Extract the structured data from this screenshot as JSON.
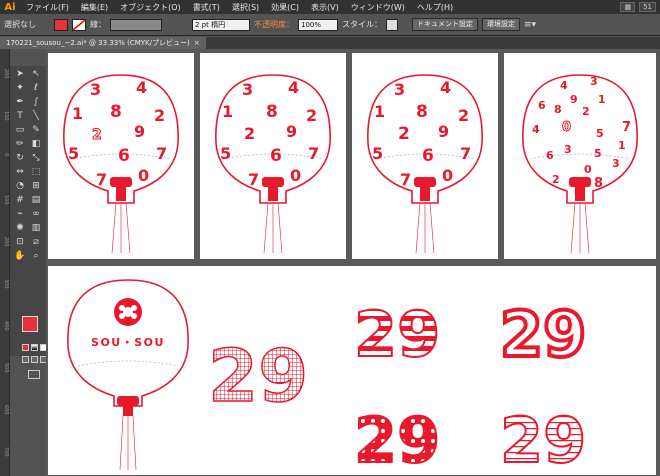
{
  "app": {
    "logo": "Ai"
  },
  "menu": [
    "ファイル(F)",
    "編集(E)",
    "オブジェクト(O)",
    "書式(T)",
    "選択(S)",
    "効果(C)",
    "表示(V)",
    "ウィンドウ(W)",
    "ヘルプ(H)"
  ],
  "workspace": {
    "arrange_label": "▦",
    "zoom_label": "51"
  },
  "control": {
    "selection": "選択なし",
    "stroke_label": "線：",
    "stroke_width": "2 pt 楕円",
    "opacity_label": "不透明度：",
    "opacity": "100%",
    "style_label": "スタイル：",
    "doc_setup": "ドキュメント設定",
    "prefs": "環境設定",
    "fill_color": "#e8303a"
  },
  "tab": {
    "title": "170221_sousou_~2.ai* @ 33.33% (CMYK/プレビュー)",
    "close": "×"
  },
  "ruler_ticks": [
    "200",
    "100",
    "0",
    "100",
    "200",
    "300",
    "400",
    "500",
    "600",
    "700"
  ],
  "colors": {
    "red": "#e8192c",
    "accent": "#e8303a"
  },
  "artboards": {
    "a1": {
      "numbers": [
        "3",
        "4",
        "1",
        "8",
        "2",
        "2",
        "9",
        "5",
        "6",
        "7",
        "7",
        "0"
      ]
    },
    "a2": {
      "numbers": [
        "3",
        "4",
        "1",
        "8",
        "2",
        "2",
        "9",
        "5",
        "6",
        "7",
        "7",
        "0"
      ]
    },
    "a3": {
      "numbers": [
        "3",
        "4",
        "1",
        "8",
        "2",
        "2",
        "9",
        "5",
        "6",
        "7",
        "7",
        "0"
      ]
    },
    "a4": {
      "numbers": [
        "4",
        "3",
        "6",
        "9",
        "1",
        "8",
        "2",
        "0",
        "7",
        "4",
        "5",
        "1",
        "3",
        "6",
        "5",
        "3",
        "0",
        "2",
        "8"
      ]
    }
  },
  "bottom": {
    "logo_text": "SOU・SOU",
    "big_number": "29",
    "variants": [
      "29",
      "29",
      "29",
      "29"
    ]
  }
}
